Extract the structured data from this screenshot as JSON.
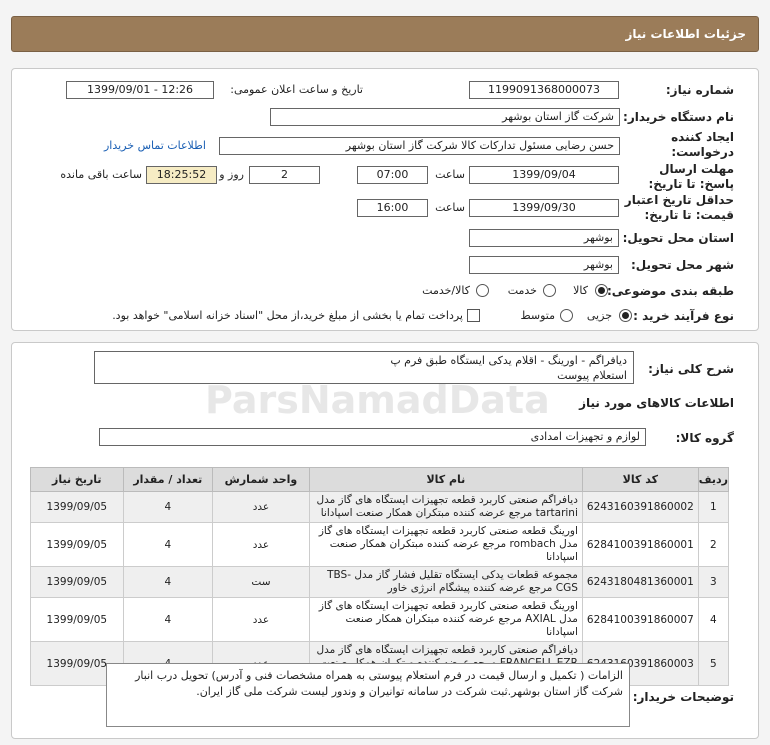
{
  "header": {
    "title": "جزئیات اطلاعات نیاز"
  },
  "info": {
    "need_number_label": "شماره نیاز:",
    "need_number": "1199091368000073",
    "announce_label": "تاریخ و ساعت اعلان عمومی:",
    "announce_value": "1399/09/01 - 12:26",
    "buyer_org_label": "نام دستگاه خریدار:",
    "buyer_org": "شرکت گاز استان بوشهر",
    "creator_label": "ایجاد کننده درخواست:",
    "creator": "حسن رضایی مسئول تدارکات کالا شرکت گاز استان بوشهر",
    "contact_link": "اطلاعات تماس خریدار",
    "send_deadline_label": "مهلت ارسال پاسخ: تا تاریخ:",
    "send_date": "1399/09/04",
    "time_label": "ساعت",
    "send_time": "07:00",
    "days_value": "2",
    "days_label": "روز و",
    "remaining_time": "18:25:52",
    "remaining_label": "ساعت باقی مانده",
    "validity_label": "حداقل تاریخ اعتبار قیمت: تا تاریخ:",
    "validity_date": "1399/09/30",
    "validity_time_label": "ساعت",
    "validity_time": "16:00",
    "province_label": "استان محل تحویل:",
    "province": "بوشهر",
    "city_label": "شهر محل تحویل:",
    "city": "بوشهر",
    "category_label": "طبقه بندی موضوعی:",
    "category_options": [
      "کالا",
      "خدمت",
      "کالا/خدمت"
    ],
    "category_selected": "کالا",
    "purchase_label": "نوع فرآیند خرید :",
    "purchase_options": [
      "جزیی",
      "متوسط"
    ],
    "purchase_selected": "جزیی",
    "payment_note": "پرداخت تمام یا بخشی از مبلغ خرید،از محل \"اسناد خزانه اسلامی\" خواهد بود."
  },
  "summary": {
    "label": "شرح کلی نیاز:",
    "line1": "دیافراگم - اورینگ - اقلام یدکی ایستگاه طبق فرم پ",
    "line2": "استعلام پیوست"
  },
  "goods": {
    "section_title": "اطلاعات کالاهای مورد نیاز",
    "group_label": "گروه کالا:",
    "group_value": "لوازم و تجهیزات امدادی",
    "columns": [
      "ردیف",
      "کد کالا",
      "نام کالا",
      "واحد شمارش",
      "تعداد / مقدار",
      "تاریخ نیاز"
    ],
    "rows": [
      {
        "idx": "1",
        "code": "6243160391860002",
        "name": "دیافراگم صنعتی کاربرد قطعه تجهیزات ایستگاه های گاز مدل tartarini مرجع عرضه کننده مبتکران همکار صنعت اسپادانا",
        "unit": "عدد",
        "qty": "4",
        "date": "1399/09/05"
      },
      {
        "idx": "2",
        "code": "6284100391860001",
        "name": "اورینگ قطعه صنعتی کاربرد قطعه تجهیزات ایستگاه های گاز مدل rombach مرجع عرضه کننده مبتکران همکار صنعت اسپادانا",
        "unit": "عدد",
        "qty": "4",
        "date": "1399/09/05"
      },
      {
        "idx": "3",
        "code": "6243180481360001",
        "name": "مجموعه قطعات یدکی ایستگاه تقلیل فشار گاز مدل -TBS CGS مرجع عرضه کننده پیشگام انرژی خاور",
        "unit": "ست",
        "qty": "4",
        "date": "1399/09/05"
      },
      {
        "idx": "4",
        "code": "6284100391860007",
        "name": "اورینگ قطعه صنعتی کاربرد قطعه تجهیزات ایستگاه های گاز مدل AXIAL مرجع عرضه کننده مبتکران همکار صنعت اسپادانا",
        "unit": "عدد",
        "qty": "4",
        "date": "1399/09/05"
      },
      {
        "idx": "5",
        "code": "6243160391860003",
        "name": "دیافراگم صنعتی کاربرد قطعه تجهیزات ایستگاه های گاز مدل FRANCELL EZR مرجع عرضه کننده مبتکران همکار صنعت اسپادانا",
        "unit": "عدد",
        "qty": "4",
        "date": "1399/09/05"
      }
    ]
  },
  "buyer_notes": {
    "label": "توضیحات خریدار:",
    "text": "الزامات ( تکمیل و ارسال قیمت در فرم استعلام پیوستی به همراه مشخصات فنی و آدرس) تحویل درب انبار شرکت گاز استان بوشهر.ثبت شرکت در سامانه توانیران و وندور لیست شرکت ملی گاز ایران."
  },
  "watermark": {
    "brand": "ParsNamadData"
  }
}
